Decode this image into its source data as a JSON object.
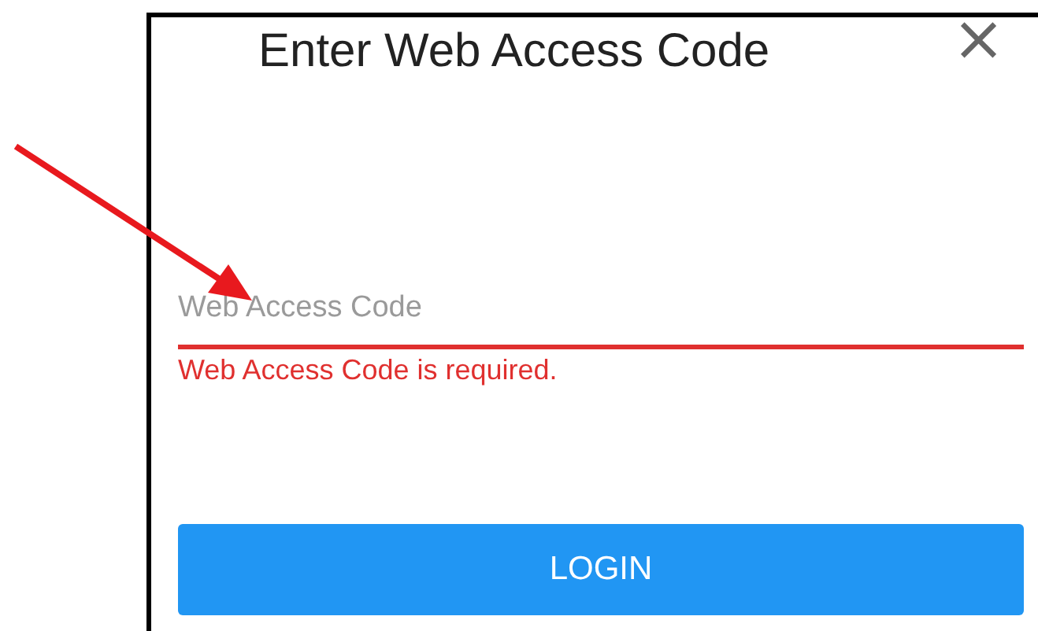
{
  "dialog": {
    "title": "Enter Web Access Code",
    "close": "×"
  },
  "field": {
    "placeholder": "Web Access Code",
    "invalid": true,
    "error": "Web Access Code is required."
  },
  "buttons": [
    "LOGIN"
  ]
}
